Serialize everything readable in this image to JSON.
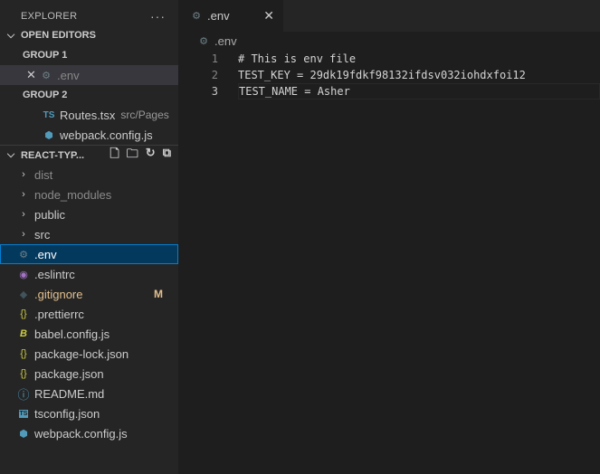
{
  "explorer": {
    "title": "EXPLORER",
    "more": "···"
  },
  "open_editors": {
    "title": "OPEN EDITORS",
    "group1": "GROUP 1",
    "group2": "GROUP 2",
    "g1_items": [
      {
        "name": ".env"
      }
    ],
    "g2_items": [
      {
        "name": "Routes.tsx",
        "desc": "src/Pages",
        "icon": "TS"
      },
      {
        "name": "webpack.config.js"
      }
    ]
  },
  "project": {
    "title": "REACT-TYP...",
    "folders": [
      "dist",
      "node_modules",
      "public",
      "src"
    ],
    "files": [
      {
        "name": ".env"
      },
      {
        "name": ".eslintrc"
      },
      {
        "name": ".gitignore",
        "badge": "M"
      },
      {
        "name": ".prettierrc"
      },
      {
        "name": "babel.config.js"
      },
      {
        "name": "package-lock.json"
      },
      {
        "name": "package.json"
      },
      {
        "name": "README.md"
      },
      {
        "name": "tsconfig.json"
      },
      {
        "name": "webpack.config.js"
      }
    ]
  },
  "tab": {
    "label": ".env"
  },
  "breadcrumb": ".env",
  "code": [
    {
      "n": "1",
      "t": "# This is env file"
    },
    {
      "n": "2",
      "t": "TEST_KEY = 29dk19fdkf98132ifdsv032iohdxfoi12"
    },
    {
      "n": "3",
      "t": "TEST_NAME = Asher"
    }
  ],
  "colors": {
    "modified": "#e2c08d",
    "accent": "#007fd4"
  }
}
